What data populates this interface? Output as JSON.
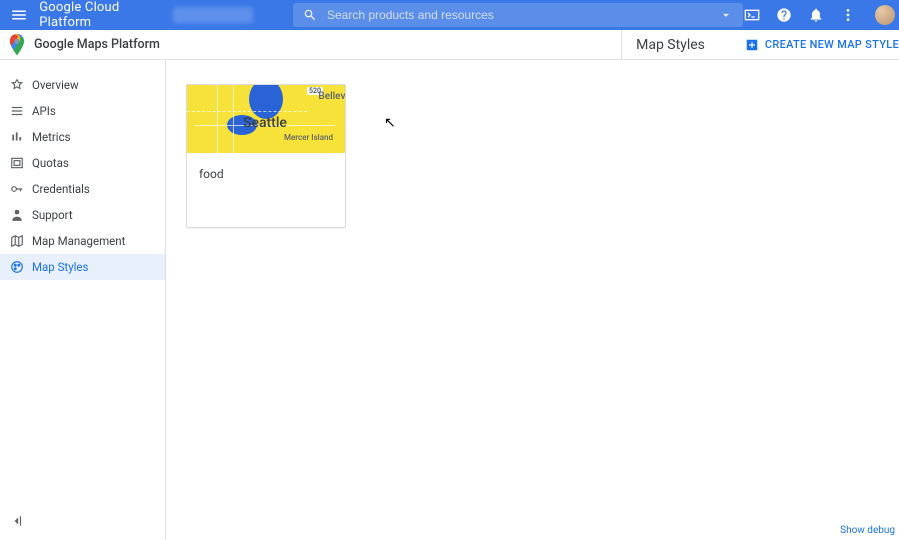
{
  "topbar": {
    "platform_name": "Google Cloud Platform",
    "search_placeholder": "Search products and resources"
  },
  "subheader": {
    "product_name": "Google Maps Platform",
    "page_title": "Map Styles",
    "create_label": "CREATE NEW MAP STYLE"
  },
  "sidebar": {
    "items": [
      {
        "label": "Overview"
      },
      {
        "label": "APIs"
      },
      {
        "label": "Metrics"
      },
      {
        "label": "Quotas"
      },
      {
        "label": "Credentials"
      },
      {
        "label": "Support"
      },
      {
        "label": "Map Management"
      },
      {
        "label": "Map Styles"
      }
    ]
  },
  "main": {
    "cards": [
      {
        "name": "food"
      }
    ],
    "map_labels": {
      "seattle": "Seattle",
      "bellevue": "Bellevu",
      "mercer": "Mercer Island",
      "route": "520"
    }
  },
  "footer": {
    "show_debug": "Show debug"
  }
}
